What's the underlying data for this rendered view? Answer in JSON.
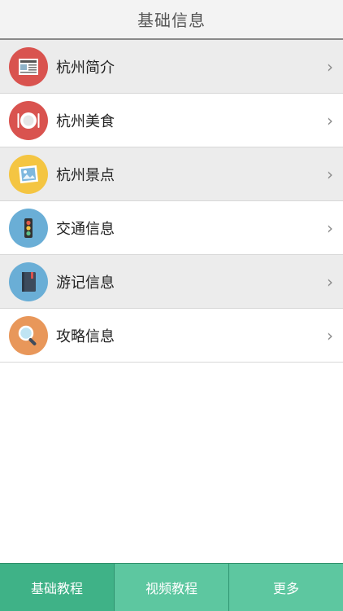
{
  "header": {
    "title": "基础信息"
  },
  "list": [
    {
      "label": "杭州简介",
      "icon": "newspaper-icon",
      "color": "#d9534f"
    },
    {
      "label": "杭州美食",
      "icon": "plate-cutlery-icon",
      "color": "#d9534f"
    },
    {
      "label": "杭州景点",
      "icon": "picture-icon",
      "color": "#f4c542"
    },
    {
      "label": "交通信息",
      "icon": "traffic-light-icon",
      "color": "#6aaed6"
    },
    {
      "label": "游记信息",
      "icon": "notebook-icon",
      "color": "#6aaed6"
    },
    {
      "label": "攻略信息",
      "icon": "magnifier-icon",
      "color": "#e8975a"
    }
  ],
  "tabs": [
    {
      "label": "基础教程",
      "active": true
    },
    {
      "label": "视频教程",
      "active": false
    },
    {
      "label": "更多",
      "active": false
    }
  ],
  "colors": {
    "tab_bg": "#5dc7a0",
    "tab_active": "#3fb287"
  }
}
